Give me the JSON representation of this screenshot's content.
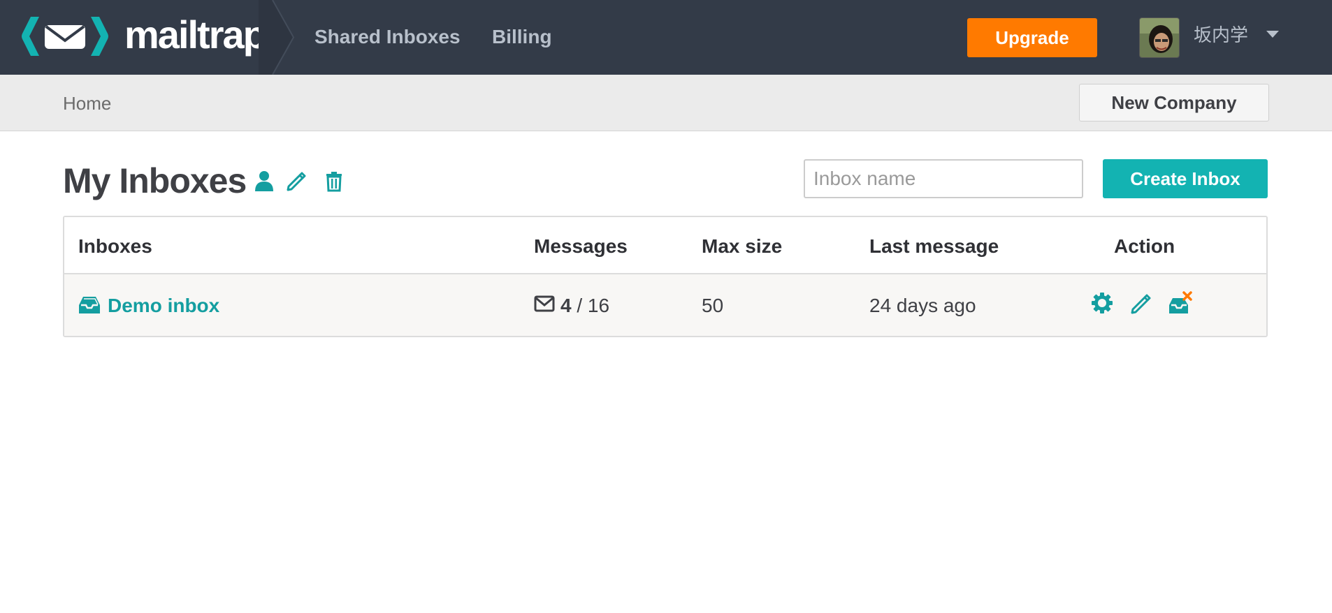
{
  "app": {
    "logo_text": "mailtrap",
    "brand_color": "#13b3b2",
    "accent_color": "#ff7a00"
  },
  "nav": {
    "links": [
      "Shared Inboxes",
      "Billing"
    ],
    "upgrade_label": "Upgrade",
    "user": {
      "name": "坂内学",
      "avatar_icon": "user-avatar"
    }
  },
  "subbar": {
    "breadcrumb": "Home",
    "new_company_label": "New Company"
  },
  "main": {
    "title": "My Inboxes",
    "title_icons": [
      "user-icon",
      "pencil-icon",
      "trash-icon"
    ],
    "search_placeholder": "Inbox name",
    "search_value": "",
    "create_label": "Create Inbox"
  },
  "table": {
    "headers": [
      "Inboxes",
      "Messages",
      "Max size",
      "Last message",
      "Action"
    ],
    "rows": [
      {
        "name": "Demo inbox",
        "messages_count": "4",
        "messages_sep": "/",
        "messages_total": "16",
        "max_size": "50",
        "last_message": "24 days ago",
        "actions": [
          "gear-icon",
          "pencil-icon",
          "clear-inbox-icon"
        ]
      }
    ]
  }
}
